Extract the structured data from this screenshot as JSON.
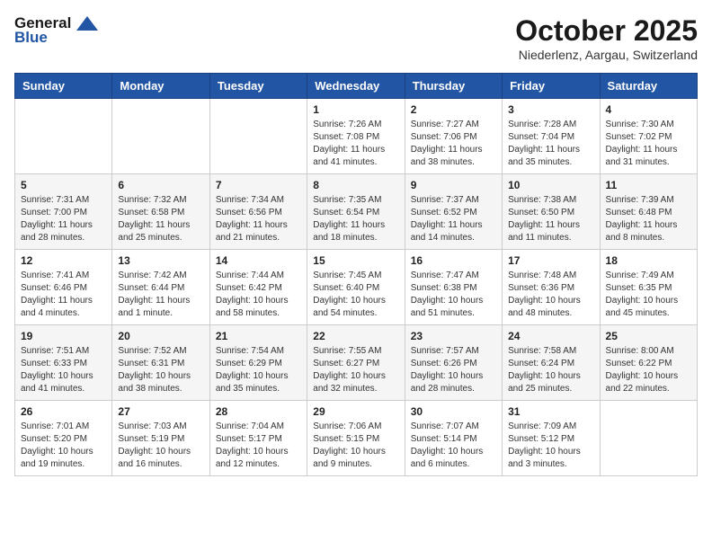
{
  "header": {
    "logo_general": "General",
    "logo_blue": "Blue",
    "month": "October 2025",
    "location": "Niederlenz, Aargau, Switzerland"
  },
  "weekdays": [
    "Sunday",
    "Monday",
    "Tuesday",
    "Wednesday",
    "Thursday",
    "Friday",
    "Saturday"
  ],
  "weeks": [
    [
      {
        "day": "",
        "info": ""
      },
      {
        "day": "",
        "info": ""
      },
      {
        "day": "",
        "info": ""
      },
      {
        "day": "1",
        "info": "Sunrise: 7:26 AM\nSunset: 7:08 PM\nDaylight: 11 hours and 41 minutes."
      },
      {
        "day": "2",
        "info": "Sunrise: 7:27 AM\nSunset: 7:06 PM\nDaylight: 11 hours and 38 minutes."
      },
      {
        "day": "3",
        "info": "Sunrise: 7:28 AM\nSunset: 7:04 PM\nDaylight: 11 hours and 35 minutes."
      },
      {
        "day": "4",
        "info": "Sunrise: 7:30 AM\nSunset: 7:02 PM\nDaylight: 11 hours and 31 minutes."
      }
    ],
    [
      {
        "day": "5",
        "info": "Sunrise: 7:31 AM\nSunset: 7:00 PM\nDaylight: 11 hours and 28 minutes."
      },
      {
        "day": "6",
        "info": "Sunrise: 7:32 AM\nSunset: 6:58 PM\nDaylight: 11 hours and 25 minutes."
      },
      {
        "day": "7",
        "info": "Sunrise: 7:34 AM\nSunset: 6:56 PM\nDaylight: 11 hours and 21 minutes."
      },
      {
        "day": "8",
        "info": "Sunrise: 7:35 AM\nSunset: 6:54 PM\nDaylight: 11 hours and 18 minutes."
      },
      {
        "day": "9",
        "info": "Sunrise: 7:37 AM\nSunset: 6:52 PM\nDaylight: 11 hours and 14 minutes."
      },
      {
        "day": "10",
        "info": "Sunrise: 7:38 AM\nSunset: 6:50 PM\nDaylight: 11 hours and 11 minutes."
      },
      {
        "day": "11",
        "info": "Sunrise: 7:39 AM\nSunset: 6:48 PM\nDaylight: 11 hours and 8 minutes."
      }
    ],
    [
      {
        "day": "12",
        "info": "Sunrise: 7:41 AM\nSunset: 6:46 PM\nDaylight: 11 hours and 4 minutes."
      },
      {
        "day": "13",
        "info": "Sunrise: 7:42 AM\nSunset: 6:44 PM\nDaylight: 11 hours and 1 minute."
      },
      {
        "day": "14",
        "info": "Sunrise: 7:44 AM\nSunset: 6:42 PM\nDaylight: 10 hours and 58 minutes."
      },
      {
        "day": "15",
        "info": "Sunrise: 7:45 AM\nSunset: 6:40 PM\nDaylight: 10 hours and 54 minutes."
      },
      {
        "day": "16",
        "info": "Sunrise: 7:47 AM\nSunset: 6:38 PM\nDaylight: 10 hours and 51 minutes."
      },
      {
        "day": "17",
        "info": "Sunrise: 7:48 AM\nSunset: 6:36 PM\nDaylight: 10 hours and 48 minutes."
      },
      {
        "day": "18",
        "info": "Sunrise: 7:49 AM\nSunset: 6:35 PM\nDaylight: 10 hours and 45 minutes."
      }
    ],
    [
      {
        "day": "19",
        "info": "Sunrise: 7:51 AM\nSunset: 6:33 PM\nDaylight: 10 hours and 41 minutes."
      },
      {
        "day": "20",
        "info": "Sunrise: 7:52 AM\nSunset: 6:31 PM\nDaylight: 10 hours and 38 minutes."
      },
      {
        "day": "21",
        "info": "Sunrise: 7:54 AM\nSunset: 6:29 PM\nDaylight: 10 hours and 35 minutes."
      },
      {
        "day": "22",
        "info": "Sunrise: 7:55 AM\nSunset: 6:27 PM\nDaylight: 10 hours and 32 minutes."
      },
      {
        "day": "23",
        "info": "Sunrise: 7:57 AM\nSunset: 6:26 PM\nDaylight: 10 hours and 28 minutes."
      },
      {
        "day": "24",
        "info": "Sunrise: 7:58 AM\nSunset: 6:24 PM\nDaylight: 10 hours and 25 minutes."
      },
      {
        "day": "25",
        "info": "Sunrise: 8:00 AM\nSunset: 6:22 PM\nDaylight: 10 hours and 22 minutes."
      }
    ],
    [
      {
        "day": "26",
        "info": "Sunrise: 7:01 AM\nSunset: 5:20 PM\nDaylight: 10 hours and 19 minutes."
      },
      {
        "day": "27",
        "info": "Sunrise: 7:03 AM\nSunset: 5:19 PM\nDaylight: 10 hours and 16 minutes."
      },
      {
        "day": "28",
        "info": "Sunrise: 7:04 AM\nSunset: 5:17 PM\nDaylight: 10 hours and 12 minutes."
      },
      {
        "day": "29",
        "info": "Sunrise: 7:06 AM\nSunset: 5:15 PM\nDaylight: 10 hours and 9 minutes."
      },
      {
        "day": "30",
        "info": "Sunrise: 7:07 AM\nSunset: 5:14 PM\nDaylight: 10 hours and 6 minutes."
      },
      {
        "day": "31",
        "info": "Sunrise: 7:09 AM\nSunset: 5:12 PM\nDaylight: 10 hours and 3 minutes."
      },
      {
        "day": "",
        "info": ""
      }
    ]
  ]
}
